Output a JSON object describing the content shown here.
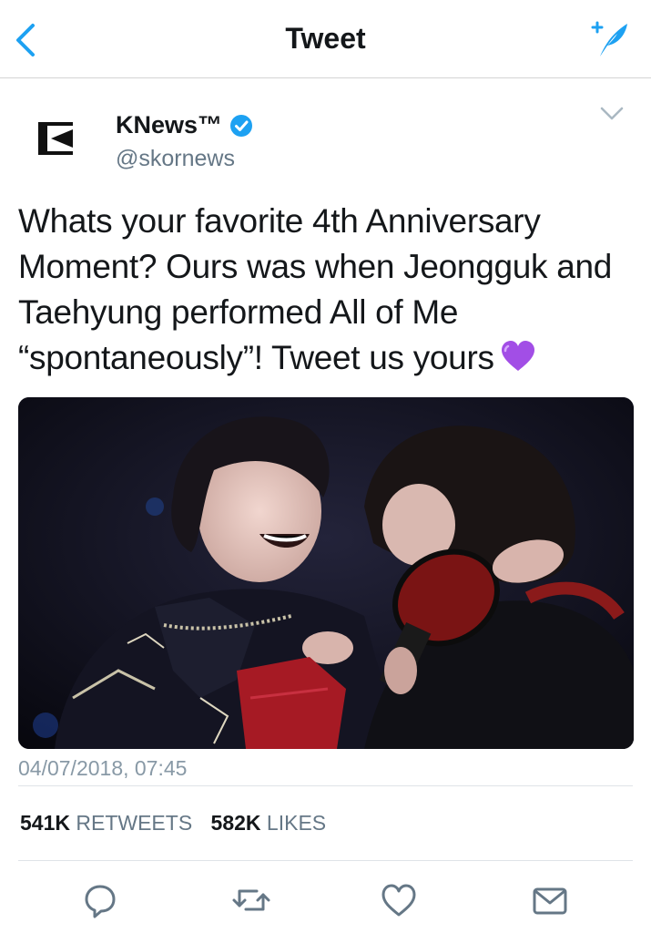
{
  "navbar": {
    "title": "Tweet",
    "back_icon": "chevron-left-icon",
    "compose_icon": "compose-tweet-icon"
  },
  "author": {
    "name": "KNews™",
    "handle": "@skornews",
    "verified": true,
    "avatar_letter": "K"
  },
  "tweet": {
    "text": "Whats your favorite 4th Anniversary Moment? Ours was when Jeongguk and Taehyung performed All of Me “spontaneously”! Tweet us yours",
    "emoji": "purple-heart",
    "timestamp": "04/07/2018, 07:45"
  },
  "stats": {
    "retweets_count": "541K",
    "retweets_label": "RETWEETS",
    "likes_count": "582K",
    "likes_label": "LIKES"
  },
  "actions": [
    "reply-icon",
    "retweet-icon",
    "like-icon",
    "share-icon"
  ],
  "colors": {
    "accent": "#1da1f2",
    "muted": "#657786",
    "purple_heart": "#a24ee6"
  }
}
